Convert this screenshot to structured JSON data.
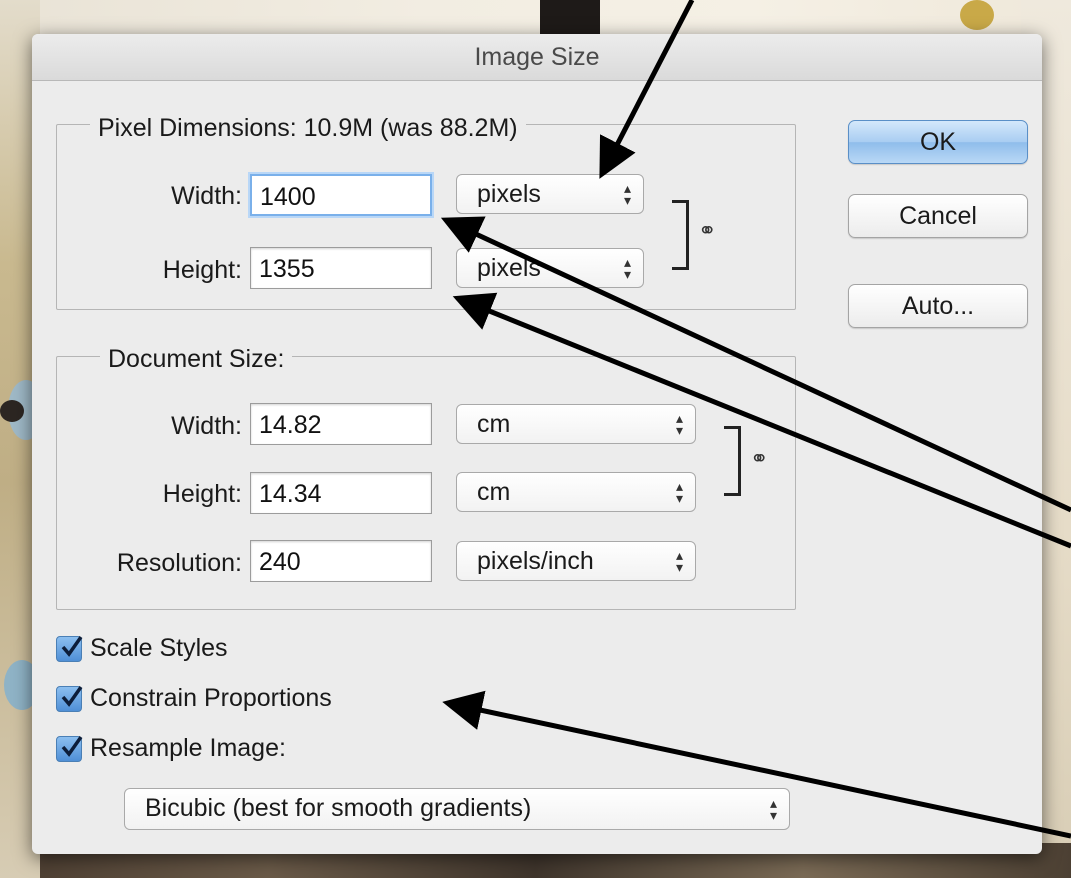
{
  "dialog": {
    "title": "Image Size"
  },
  "pixel_dimensions": {
    "legend": "Pixel Dimensions:  10.9M (was 88.2M)",
    "width_label": "Width:",
    "width_value": "1400",
    "width_unit": "pixels",
    "height_label": "Height:",
    "height_value": "1355",
    "height_unit": "pixels"
  },
  "document_size": {
    "legend": "Document Size:",
    "width_label": "Width:",
    "width_value": "14.82",
    "width_unit": "cm",
    "height_label": "Height:",
    "height_value": "14.34",
    "height_unit": "cm",
    "resolution_label": "Resolution:",
    "resolution_value": "240",
    "resolution_unit": "pixels/inch"
  },
  "buttons": {
    "ok": "OK",
    "cancel": "Cancel",
    "auto": "Auto..."
  },
  "options": {
    "scale_styles": "Scale Styles",
    "constrain_proportions": "Constrain Proportions",
    "resample_image": "Resample Image:",
    "resample_method": "Bicubic (best for smooth gradients)"
  },
  "colors": {
    "dialog_bg": "#ececec",
    "default_button": "#a9cdf2",
    "checkbox": "#4f8fd6",
    "focus_ring": "#7ab0ea"
  }
}
